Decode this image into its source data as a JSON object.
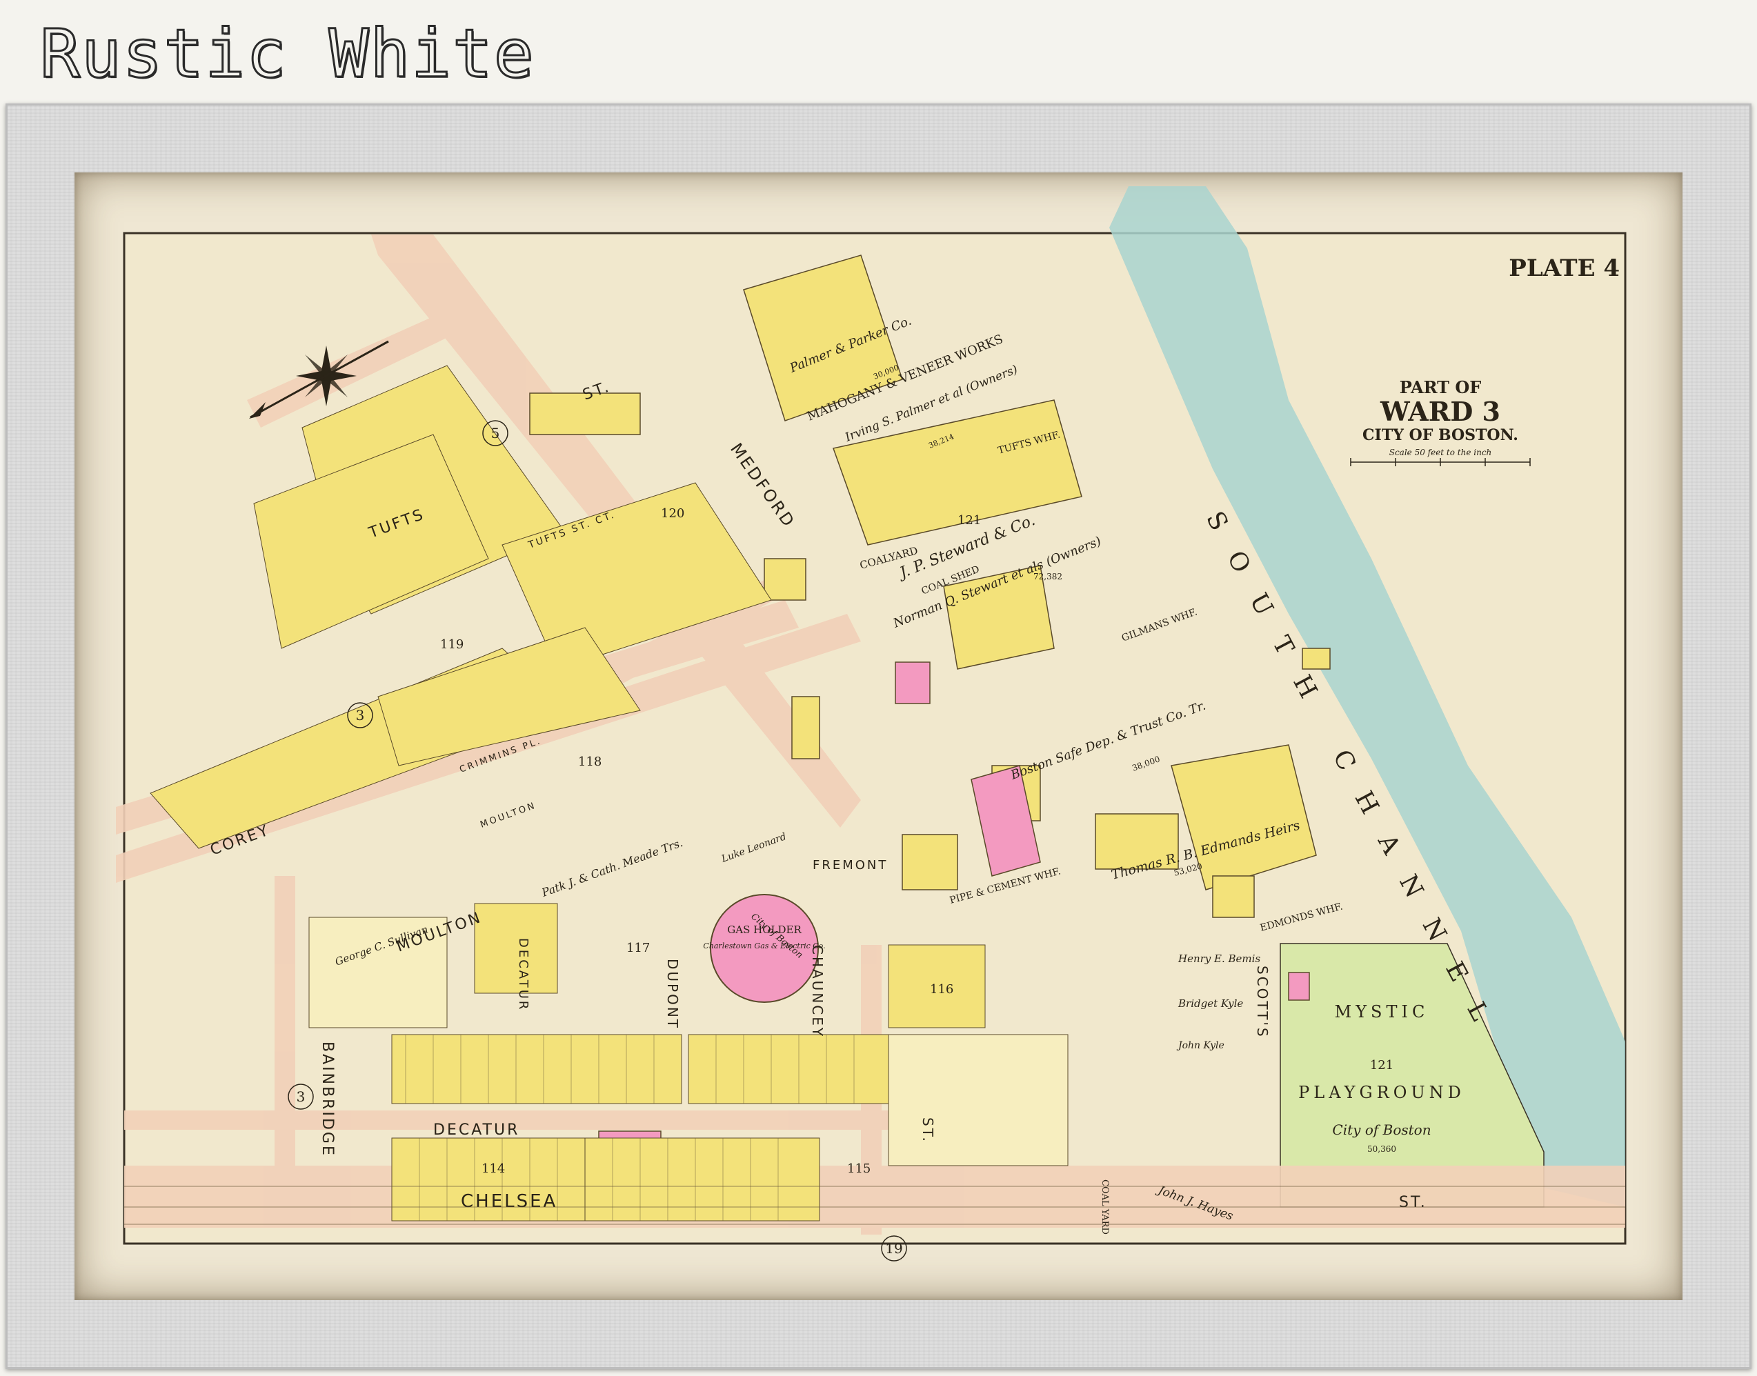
{
  "banner": {
    "title": "Rustic White"
  },
  "plate": "PLATE 4",
  "ward": {
    "line1": "PART OF",
    "line2": "WARD 3",
    "line3": "CITY OF BOSTON.",
    "scale": "Scale 50 feet to the inch"
  },
  "water": {
    "channel": "SOUTH CHANNEL"
  },
  "streets": {
    "tufts": "TUFTS",
    "st": "ST.",
    "medford": "MEDFORD",
    "corey": "COREY",
    "moulton": "MOULTON",
    "bainbridge": "BAINBRIDGE",
    "decatur": "DECATUR",
    "dupont": "DUPONT",
    "chauncey": "CHAUNCEY",
    "fremont": "FREMONT",
    "scotts": "SCOTT'S",
    "chelsea": "CHELSEA",
    "tufts_st_ct": "TUFTS ST. CT.",
    "crimmins_pl": "CRIMMINS PL.",
    "ct": "CT.",
    "pl": "PL.",
    "moulton_small": "MOULTON"
  },
  "wharves": {
    "tufts": "TUFTS WHF.",
    "gilmans": "GILMANS WHF.",
    "edmonds": "EDMONDS WHF.",
    "pipe": "PIPE & CEMENT WHF."
  },
  "owners": {
    "palmer": "Palmer & Parker Co.",
    "mahogany": "MAHOGANY & VENEER WORKS",
    "irving": "Irving S. Palmer et al (Owners)",
    "coalyard": "COALYARD",
    "steward": "J. P. Steward & Co.",
    "coalshed": "COAL SHED",
    "norman": "Norman Q. Stewart et als (Owners)",
    "boston_safe": "Boston Safe Dep. & Trust Co. Tr.",
    "edmonds": "Thomas R. B. Edmands Heirs",
    "gasholder": "GAS HOLDER",
    "gas_co": "Charlestown Gas & Electric Co.",
    "mystic": "MYSTIC",
    "playground": "PLAYGROUND",
    "city_of_boston": "City of Boston",
    "henry": "Henry E. Bemis",
    "bridget": "Bridget Kyle",
    "john_kyle": "John Kyle",
    "coal_yard": "COAL YARD",
    "john_hayes": "John J. Hayes",
    "lake_leonard": "Luke Leonard",
    "city_boston_small": "City of Boston",
    "patk": "Patk J. & Cath. Meade Trs.",
    "george": "George C. Sullivan"
  },
  "blocks": [
    "121",
    "120",
    "119",
    "118",
    "117",
    "116",
    "115",
    "114",
    "121"
  ],
  "wards_circles": [
    "5",
    "3",
    "3",
    "19"
  ],
  "areas": {
    "steward": "72,382",
    "boston_safe": "38,000",
    "edmonds": "53,020",
    "mystic": "50,360",
    "palmer": "30,000",
    "irving": "38,214"
  },
  "colors": {
    "yellow": "#f3e27a",
    "pink": "#f39ac0",
    "blue": "#a9d3cf",
    "green": "#d9e8a9",
    "paper": "#f1e8cd",
    "road": "#f2d0b8",
    "ink": "#2b2418"
  }
}
